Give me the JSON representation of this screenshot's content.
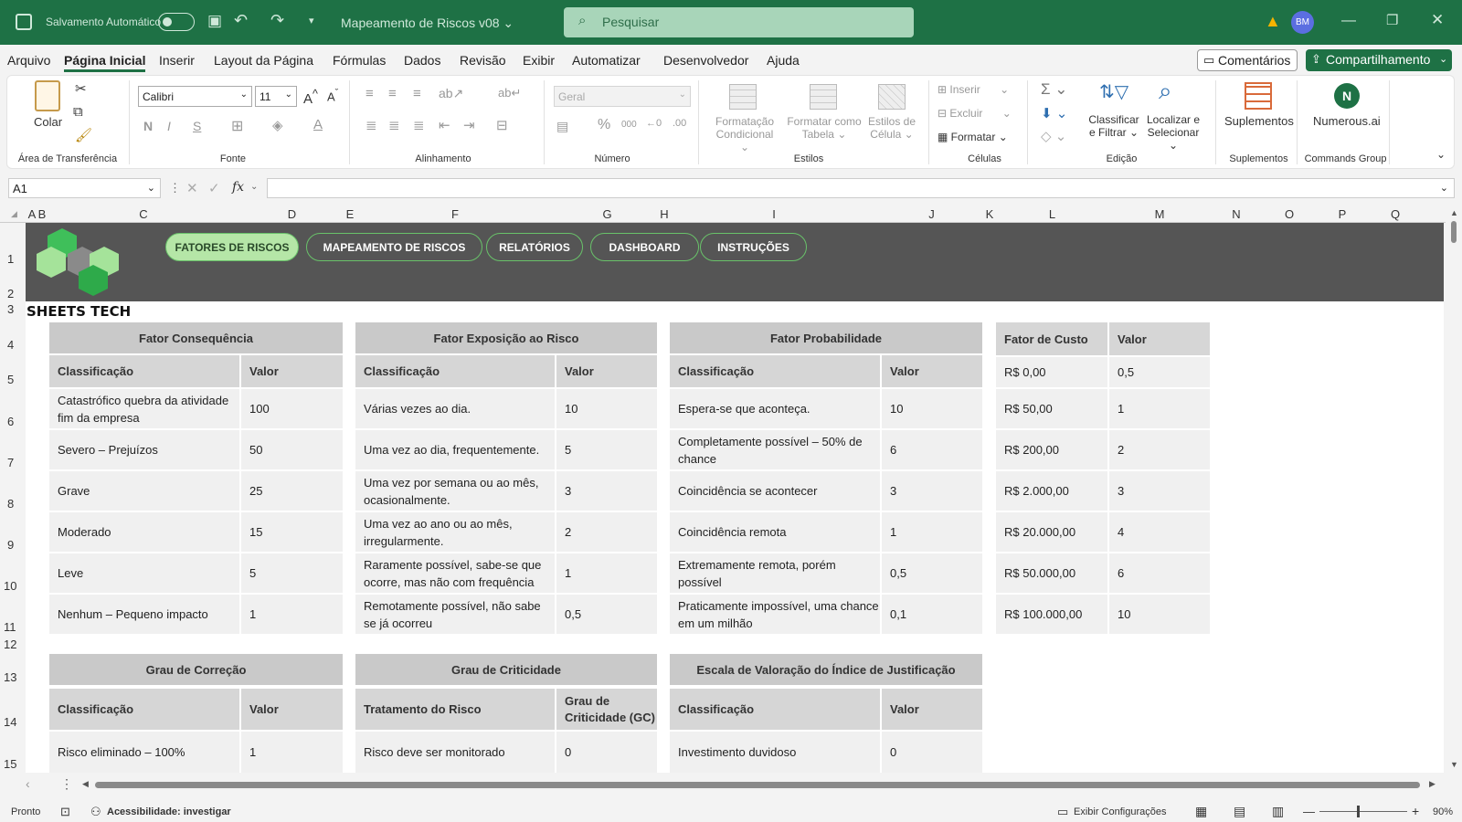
{
  "titlebar": {
    "autosave_label": "Salvamento Automático",
    "filename": "Mapeamento de Riscos v08",
    "search_placeholder": "Pesquisar",
    "avatar": "BM",
    "accent": "#1e7145"
  },
  "menu": {
    "items": [
      "Arquivo",
      "Página Inicial",
      "Inserir",
      "Layout da Página",
      "Fórmulas",
      "Dados",
      "Revisão",
      "Exibir",
      "Automatizar",
      "Desenvolvedor",
      "Ajuda"
    ],
    "active": "Página Inicial",
    "comments": "Comentários",
    "share": "Compartilhamento"
  },
  "ribbon": {
    "paste": "Colar",
    "font_name": "Calibri",
    "font_size": "11",
    "number_format": "Geral",
    "cond_format_1": "Formatação",
    "cond_format_2": "Condicional",
    "format_table_1": "Formatar como",
    "format_table_2": "Tabela",
    "cell_styles_1": "Estilos de",
    "cell_styles_2": "Célula",
    "insert": "Inserir",
    "delete": "Excluir",
    "format": "Formatar",
    "sort_1": "Classificar",
    "sort_2": "e Filtrar",
    "find_1": "Localizar e",
    "find_2": "Selecionar",
    "addins": "Suplementos",
    "numerous": "Numerous.ai",
    "groups": [
      "Área de Transferência",
      "Fonte",
      "Alinhamento",
      "Número",
      "Estilos",
      "Células",
      "Edição",
      "Suplementos",
      "Commands Group"
    ]
  },
  "formula_bar": {
    "name_box": "A1",
    "fx": "fx",
    "formula": ""
  },
  "columns": [
    "A",
    "B",
    "C",
    "D",
    "E",
    "F",
    "G",
    "H",
    "I",
    "J",
    "K",
    "L",
    "M",
    "N",
    "O",
    "P",
    "Q"
  ],
  "rows": [
    "1",
    "2",
    "3",
    "4",
    "5",
    "6",
    "7",
    "8",
    "9",
    "10",
    "11",
    "12",
    "13",
    "14",
    "15"
  ],
  "nav": [
    "FATORES DE RISCOS",
    "MAPEAMENTO DE RISCOS",
    "RELATÓRIOS",
    "DASHBOARD",
    "INSTRUÇÕES"
  ],
  "brand": "SHEETS TECH",
  "tables": {
    "consequencia": {
      "title": "Fator Consequência",
      "headers": [
        "Classificação",
        "Valor"
      ],
      "rows": [
        [
          "Catastrófico quebra da atividade fim da empresa",
          "100"
        ],
        [
          "Severo – Prejuízos",
          "50"
        ],
        [
          "Grave",
          "25"
        ],
        [
          "Moderado",
          "15"
        ],
        [
          "Leve",
          "5"
        ],
        [
          "Nenhum – Pequeno impacto",
          "1"
        ]
      ]
    },
    "exposicao": {
      "title": "Fator Exposição ao Risco",
      "headers": [
        "Classificação",
        "Valor"
      ],
      "rows": [
        [
          "Várias vezes ao dia.",
          "10"
        ],
        [
          "Uma vez ao dia, frequentemente.",
          "5"
        ],
        [
          "Uma vez por semana ou ao mês, ocasionalmente.",
          "3"
        ],
        [
          "Uma vez ao ano ou ao mês, irregularmente.",
          "2"
        ],
        [
          "Raramente possível, sabe-se que ocorre, mas não com frequência",
          "1"
        ],
        [
          "Remotamente possível, não sabe se já ocorreu",
          "0,5"
        ]
      ]
    },
    "probabilidade": {
      "title": "Fator Probabilidade",
      "headers": [
        "Classificação",
        "Valor"
      ],
      "rows": [
        [
          "Espera-se que aconteça.",
          "10"
        ],
        [
          "Completamente possível – 50% de chance",
          "6"
        ],
        [
          "Coincidência se acontecer",
          "3"
        ],
        [
          "Coincidência remota",
          "1"
        ],
        [
          "Extremamente remota, porém possível",
          "0,5"
        ],
        [
          "Praticamente impossível, uma chance em um milhão",
          "0,1"
        ]
      ]
    },
    "custo": {
      "headers": [
        "Fator de Custo",
        "Valor"
      ],
      "rows": [
        [
          "R$ 0,00",
          "0,5"
        ],
        [
          "R$ 50,00",
          "1"
        ],
        [
          "R$ 200,00",
          "2"
        ],
        [
          "R$ 2.000,00",
          "3"
        ],
        [
          "R$ 20.000,00",
          "4"
        ],
        [
          "R$ 50.000,00",
          "6"
        ],
        [
          "R$ 100.000,00",
          "10"
        ]
      ]
    },
    "correcao": {
      "title": "Grau de Correção",
      "headers": [
        "Classificação",
        "Valor"
      ],
      "rows": [
        [
          "Risco eliminado – 100%",
          "1"
        ]
      ]
    },
    "criticidade": {
      "title": "Grau de Criticidade",
      "headers": [
        "Tratamento do Risco",
        "Grau de Criticidade (GC)"
      ],
      "rows": [
        [
          "Risco deve ser monitorado",
          "0"
        ]
      ]
    },
    "justificacao": {
      "title": "Escala de Valoração do Índice de Justificação",
      "headers": [
        "Classificação",
        "Valor"
      ],
      "rows": [
        [
          "Investimento duvidoso",
          "0"
        ]
      ]
    }
  },
  "status": {
    "ready": "Pronto",
    "accessibility": "Acessibilidade: investigar",
    "display_settings": "Exibir Configurações",
    "zoom": "90%"
  }
}
